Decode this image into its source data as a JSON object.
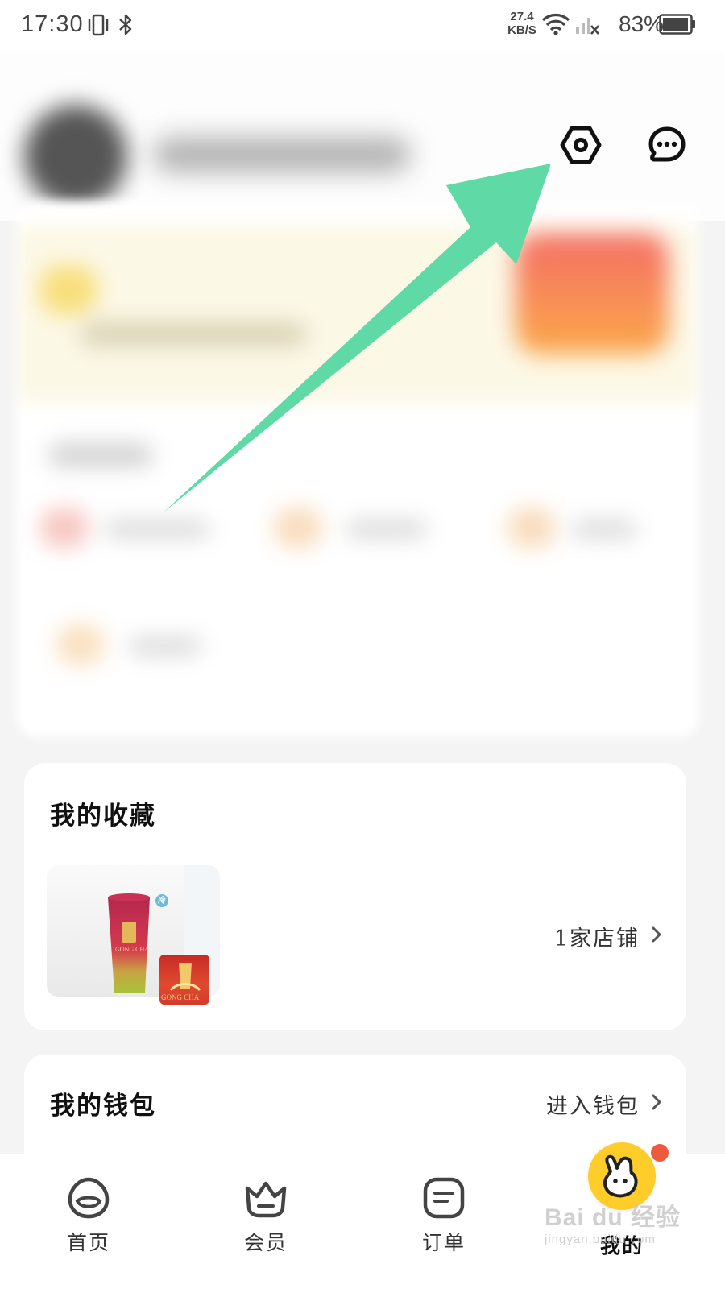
{
  "status_bar": {
    "time": "17:30",
    "net_speed_value": "27.4",
    "net_speed_unit": "KB/S",
    "battery": "83%",
    "icons": [
      "vibrate-icon",
      "bluetooth-icon",
      "wifi-icon",
      "signal-off-icon",
      "battery-icon"
    ]
  },
  "header": {
    "icons": [
      "settings-icon",
      "message-icon"
    ]
  },
  "favorites": {
    "title": "我的收藏",
    "link_text": "1家店铺",
    "thumb_brand": "GONG CHA",
    "thumb_tag": "冷"
  },
  "wallet": {
    "title": "我的钱包",
    "link_text": "进入钱包"
  },
  "bottom_nav": {
    "items": [
      {
        "label": "首页",
        "icon": "home-icon"
      },
      {
        "label": "会员",
        "icon": "member-crown-icon"
      },
      {
        "label": "订单",
        "icon": "order-icon"
      },
      {
        "label": "我的",
        "icon": "mine-mascot-icon",
        "active": true
      }
    ]
  },
  "watermark": {
    "text": "Bai du 经验",
    "sub": "jingyan.baidu.com"
  },
  "colors": {
    "arrow": "#5fd9a5",
    "background": "#f4f4f4",
    "card": "#ffffff",
    "mine_badge": "#ffcd2a"
  }
}
